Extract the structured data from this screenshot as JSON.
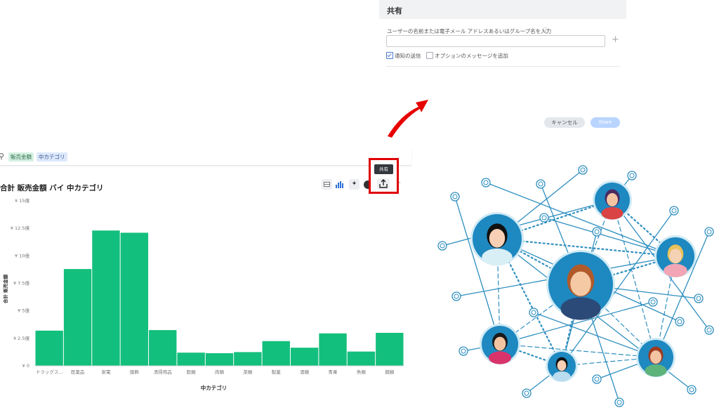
{
  "share_dialog": {
    "title": "共有",
    "input_label": "ユーザーの名前または電子メール アドレスあるいはグループ名を入力",
    "input_value": "",
    "info_icon": "info-icon",
    "add_icon": "plus-icon",
    "notify_label": "通知の送信",
    "notify_checked": true,
    "message_label": "オプションのメッセージを追加",
    "message_checked": false,
    "cancel_label": "キャンセル",
    "share_label": "Share"
  },
  "search": {
    "tokens": [
      "販売金額",
      "中カテゴリ"
    ]
  },
  "answer": {
    "title": "合計 販売金額 バイ 中カテゴリ",
    "share_tooltip": "共有",
    "toolbar_icons": [
      "table-icon",
      "bar-chart-icon",
      "pin-icon",
      "share-icon",
      "more-icon"
    ]
  },
  "colors": {
    "bar": "#13bf7c",
    "highlight": "#e00000",
    "arrow": "#e60000",
    "network": "#2f8fc0"
  },
  "chart_data": {
    "type": "bar",
    "title": "合計 販売金額 バイ 中カテゴリ",
    "xlabel": "中カテゴリ",
    "ylabel": "合計 販売金額",
    "ylim": [
      0,
      15
    ],
    "y_unit": "億",
    "yticks": [
      "¥ 0",
      "¥ 2.5億",
      "¥ 5億",
      "¥ 7.5億",
      "¥ 10億",
      "¥ 12.5億",
      "¥ 15億"
    ],
    "categories": [
      "ドラッグス...",
      "医薬品",
      "家電",
      "服飾",
      "清掃用品",
      "穀類",
      "肉類",
      "菜類",
      "製菓",
      "酒類",
      "青果",
      "魚類",
      "麺類"
    ],
    "values": [
      3.2,
      8.8,
      12.3,
      12.1,
      3.25,
      1.2,
      1.15,
      1.25,
      2.25,
      1.65,
      2.95,
      1.3,
      3.0
    ]
  }
}
